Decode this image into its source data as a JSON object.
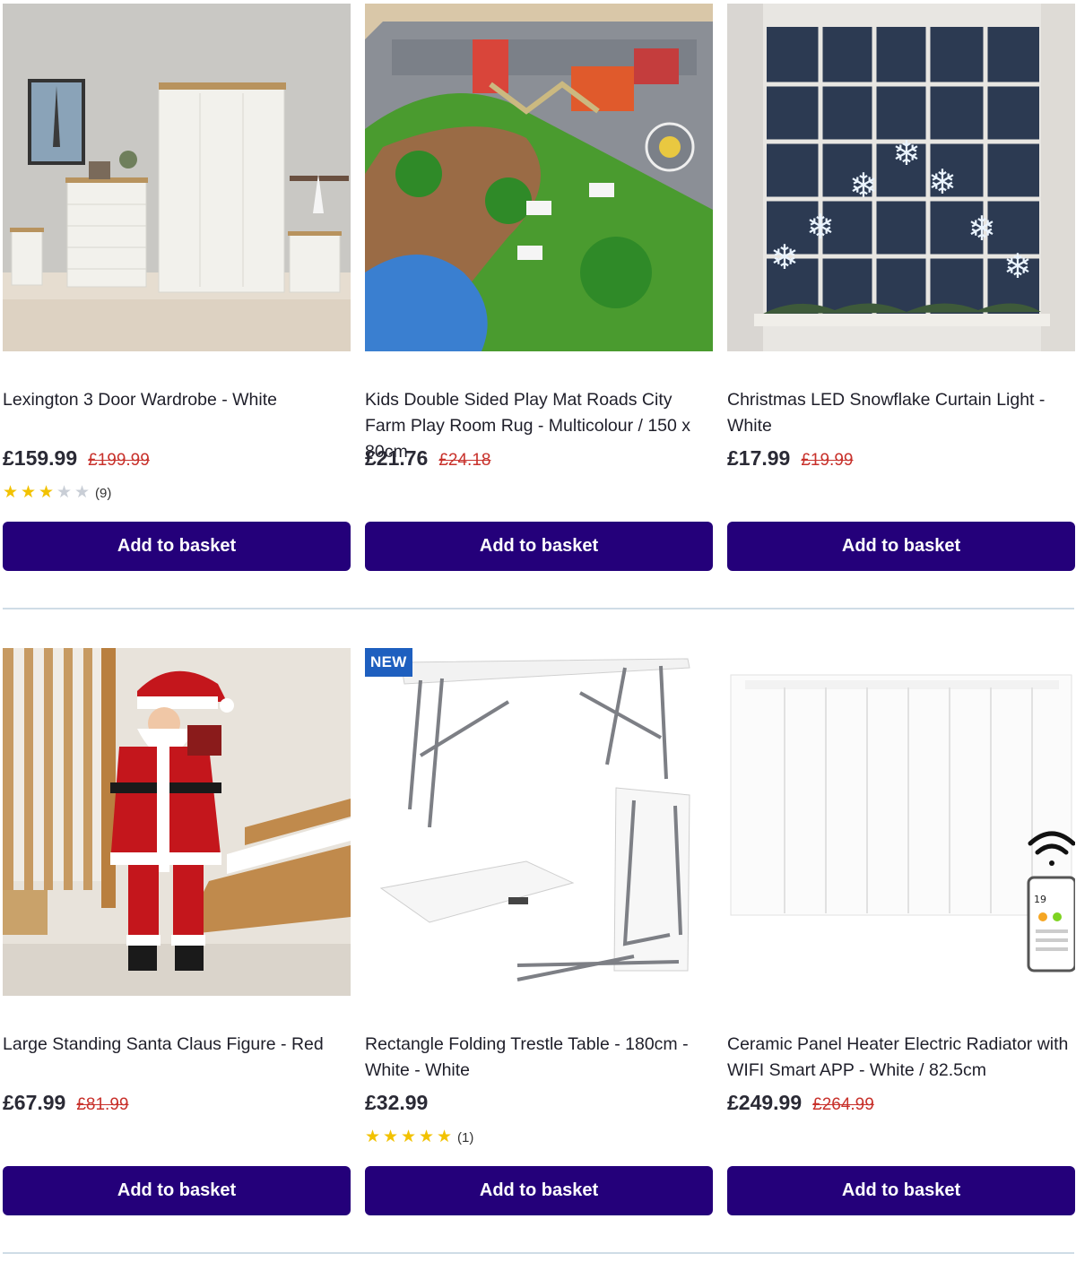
{
  "products": [
    {
      "title": "Lexington 3 Door Wardrobe - White",
      "price": "£159.99",
      "was_price": "£199.99",
      "rating": 3,
      "review_count": "(9)",
      "button": "Add to basket"
    },
    {
      "title": "Kids Double Sided Play Mat Roads City Farm Play Room Rug - Multicolour / 150 x 80cm",
      "price": "£21.76",
      "was_price": "£24.18",
      "button": "Add to basket"
    },
    {
      "title": "Christmas LED Snowflake Curtain Light - White",
      "price": "£17.99",
      "was_price": "£19.99",
      "button": "Add to basket"
    },
    {
      "title": "Large Standing Santa Claus Figure - Red",
      "price": "£67.99",
      "was_price": "£81.99",
      "button": "Add to basket"
    },
    {
      "badge": "NEW",
      "title": "Rectangle Folding Trestle Table - 180cm - White - White",
      "price": "£32.99",
      "rating": 5,
      "review_count": "(1)",
      "button": "Add to basket"
    },
    {
      "title": "Ceramic Panel Heater Electric Radiator with WIFI Smart APP - White / 82.5cm",
      "price": "£249.99",
      "was_price": "£264.99",
      "phone_temp": "19",
      "button": "Add to basket"
    }
  ],
  "colors": {
    "button_bg": "#24007a",
    "was_price": "#c8312b",
    "star_filled": "#f2c200",
    "star_empty": "#c9ced6",
    "badge_bg": "#1e5fbf"
  },
  "icons": {
    "star": "star-icon",
    "wifi": "wifi-icon"
  }
}
